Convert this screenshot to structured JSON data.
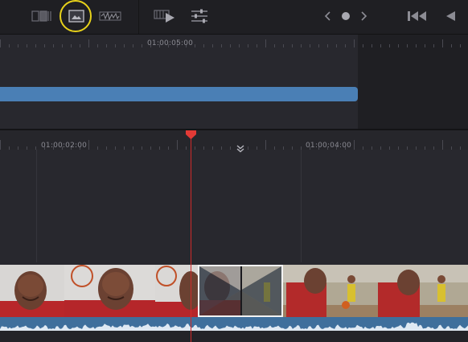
{
  "toolbar": {
    "buttons": [
      {
        "name": "clip-view-icon"
      },
      {
        "name": "viewer-icon"
      },
      {
        "name": "waveform-icon"
      },
      {
        "name": "playback-icon"
      },
      {
        "name": "mixer-sliders-icon"
      },
      {
        "name": "prev-chevron-icon"
      },
      {
        "name": "marker-dot-icon"
      },
      {
        "name": "next-chevron-icon"
      },
      {
        "name": "go-to-start-icon"
      },
      {
        "name": "play-reverse-icon"
      }
    ],
    "highlight_color": "#e8d21a"
  },
  "upper_timeline": {
    "timecode": "01:00:05:00",
    "clip_color": "#4a7fb5"
  },
  "lower_timeline": {
    "timecodes": [
      "01:00:02:00",
      "01:00:04:00"
    ],
    "playhead_color": "#d02a2a",
    "audio_color": "#3f6f9c"
  },
  "transition": {
    "name": "cross-dissolve"
  }
}
